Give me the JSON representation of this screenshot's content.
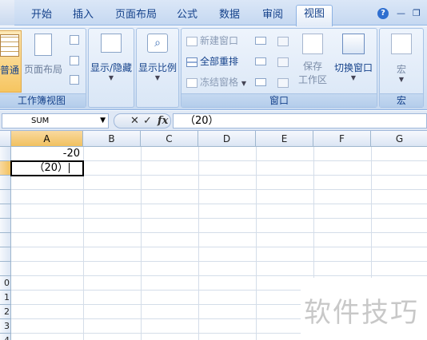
{
  "tabs": [
    "开始",
    "插入",
    "页面布局",
    "公式",
    "数据",
    "审阅",
    "视图"
  ],
  "active_tab": "视图",
  "help_glyph": "?",
  "ribbon": {
    "workbook_views": {
      "label": "工作簿视图",
      "normal": "普通",
      "page_layout": "页面布局"
    },
    "show_hide": "显示/隐藏",
    "zoom": "显示比例",
    "window": {
      "label": "窗口",
      "new_window": "新建窗口",
      "arrange_all": "全部重排",
      "freeze_panes": "冻结窗格",
      "save_workspace_1": "保存",
      "save_workspace_2": "工作区",
      "switch_windows": "切换窗口"
    },
    "macros": {
      "label": "宏",
      "button": "宏"
    }
  },
  "formula_bar": {
    "name_box": "SUM",
    "cancel": "✕",
    "enter": "✓",
    "fx": "fx",
    "content": "（20）"
  },
  "columns": [
    "A",
    "B",
    "C",
    "D",
    "E",
    "F",
    "G"
  ],
  "selected_column": "A",
  "rows": [
    "",
    "",
    "",
    "",
    "",
    "",
    "",
    "",
    "",
    "0",
    "1",
    "2",
    "3",
    "4"
  ],
  "cells": {
    "A1": "-20",
    "A2": "（20）"
  },
  "watermark": "软件技巧"
}
